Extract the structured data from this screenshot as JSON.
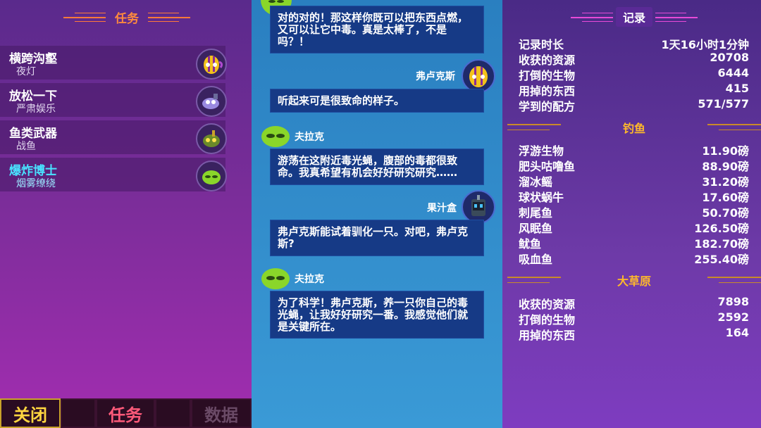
{
  "quests": {
    "header": "任务",
    "items": [
      {
        "name": "横跨沟壑",
        "sub": "夜灯",
        "icon": "yellow-mask-creature-icon"
      },
      {
        "name": "放松一下",
        "sub": "严肃娱乐",
        "icon": "purple-fish-icon"
      },
      {
        "name": "鱼类武器",
        "sub": "战鱼",
        "icon": "green-armored-fish-icon"
      },
      {
        "name": "爆炸博士",
        "sub": "烟雾缭绕",
        "icon": "green-blob-icon",
        "active": true
      }
    ]
  },
  "tabs": {
    "close": "关闭",
    "quests": "任务",
    "data": "数据"
  },
  "chat": [
    {
      "speaker": "",
      "text": "对的对的！那这样你既可以把东西点燃，又可以让它中毒。真是太棒了，不是吗？！"
    },
    {
      "speaker": "弗卢克斯",
      "text": "听起来可是很致命的样子。"
    },
    {
      "speaker": "夫拉克",
      "text": "游荡在这附近毒光蝇，腹部的毒都很致命。我真希望有机会好好研究研究……"
    },
    {
      "speaker": "果汁盒",
      "text": "弗卢克斯能试着驯化一只。对吧，弗卢克斯?"
    },
    {
      "speaker": "夫拉克",
      "text": "为了科学！弗卢克斯，养一只你自己的毒光蝇，让我好好研究一番。我感觉他们就是关键所在。"
    }
  ],
  "records": {
    "header": "记录",
    "general": [
      {
        "label": "记录时长",
        "value": "1天16小时1分钟"
      },
      {
        "label": "收获的资源",
        "value": "20708"
      },
      {
        "label": "打倒的生物",
        "value": "6444"
      },
      {
        "label": "用掉的东西",
        "value": "415"
      },
      {
        "label": "学到的配方",
        "value": "571/577"
      }
    ],
    "fishing_title": "钓鱼",
    "fishing": [
      {
        "label": "浮游生物",
        "value": "11.90磅"
      },
      {
        "label": "肥头咕噜鱼",
        "value": "88.90磅"
      },
      {
        "label": "溜冰鳐",
        "value": "31.20磅"
      },
      {
        "label": "球状蜗牛",
        "value": "17.60磅"
      },
      {
        "label": "刺尾鱼",
        "value": "50.70磅"
      },
      {
        "label": "风眠鱼",
        "value": "126.50磅"
      },
      {
        "label": "鱿鱼",
        "value": "182.70磅"
      },
      {
        "label": "吸血鱼",
        "value": "255.40磅"
      }
    ],
    "savanna_title": "大草原",
    "savanna": [
      {
        "label": "收获的资源",
        "value": "7898"
      },
      {
        "label": "打倒的生物",
        "value": "2592"
      },
      {
        "label": "用掉的东西",
        "value": "164"
      }
    ]
  },
  "colors": {
    "quest_accent": "#ff8a3d",
    "active": "#49e3ff",
    "bubble": "#163a86",
    "subhead": "#ffb92a"
  }
}
